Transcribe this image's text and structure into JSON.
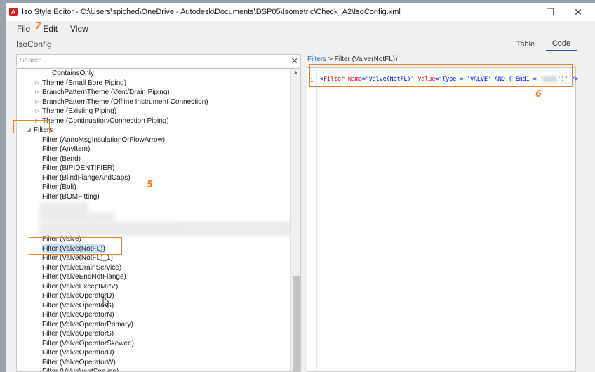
{
  "window": {
    "title": "Iso Style Editor - C:\\Users\\spiched\\OneDrive - Autodesk\\Documents\\DSP05\\Isometric\\Check_A2\\IsoConfig.xml",
    "app_icon": "A",
    "minimize_icon": "—",
    "maximize_icon": "☐",
    "close_icon": "✕"
  },
  "menu": {
    "items": [
      "File",
      "Edit",
      "View"
    ]
  },
  "doc_title": "IsoConfig",
  "view_tabs": [
    "Table",
    "Code"
  ],
  "active_view_tab": "Code",
  "search": {
    "placeholder": "Search...",
    "clear_icon": "✕"
  },
  "tree": {
    "rows": [
      {
        "label": "ContainsOnly",
        "arrow": ""
      },
      {
        "label": "Theme (Small Bore Piping)",
        "arrow": "▷"
      },
      {
        "label": "BranchPatternTheme (Vent/Drain Piping)",
        "arrow": "▷"
      },
      {
        "label": "BranchPatternTheme (Offline Instrument Connection)",
        "arrow": "▷"
      },
      {
        "label": "Theme (Existing Piping)",
        "arrow": "▷"
      },
      {
        "label": "Theme (Continuation/Connection Piping)",
        "arrow": "▷"
      },
      {
        "label": "Filters",
        "arrow": "◢"
      },
      {
        "label": "Filter (AnnoMsgInsulationOrFlowArrow)",
        "arrow": ""
      },
      {
        "label": "Filter (AnyItem)",
        "arrow": ""
      },
      {
        "label": "Filter (Bend)",
        "arrow": ""
      },
      {
        "label": "Filter (BIPIDENTIFIER)",
        "arrow": ""
      },
      {
        "label": "Filter (BlindFlangeAndCaps)",
        "arrow": ""
      },
      {
        "label": "Filter (Bolt)",
        "arrow": ""
      },
      {
        "label": "Filter (BOMFitting)",
        "arrow": ""
      }
    ],
    "rows_lower": [
      {
        "label": "Filter (Valve)",
        "arrow": ""
      },
      {
        "label": "Filter (Valve(NotFL))",
        "arrow": ""
      },
      {
        "label": "Filter (Valve(NotFL)_1)",
        "arrow": ""
      },
      {
        "label": "Filter (ValveDrainService)",
        "arrow": ""
      },
      {
        "label": "Filter (ValveEndNotFlange)",
        "arrow": ""
      },
      {
        "label": "Filter (ValveExceptMPV)",
        "arrow": ""
      },
      {
        "label": "Filter (ValveOperatorD)",
        "arrow": ""
      },
      {
        "label": "Filter (ValveOperatorS)",
        "arrow": ""
      },
      {
        "label": "Filter (ValveOperatorN)",
        "arrow": ""
      },
      {
        "label": "Filter (ValveOperatorPrimary)",
        "arrow": ""
      },
      {
        "label": "Filter (ValveOperatorS)",
        "arrow": ""
      },
      {
        "label": "Filter (ValveOperatorSkewed)",
        "arrow": ""
      },
      {
        "label": "Filter (ValveOperatorU)",
        "arrow": ""
      },
      {
        "label": "Filter (ValveOperatorW)",
        "arrow": ""
      },
      {
        "label": "Filter (ValveVentService)",
        "arrow": ""
      }
    ],
    "selected_label": "Filter (Valve(NotFL))"
  },
  "breadcrumb": {
    "root": "Filters",
    "separator": ">",
    "current": "Filter (Valve(NotFL))"
  },
  "code": {
    "line_number": "1",
    "open": "<",
    "tag": "Filter",
    "attr1_name": "Name",
    "attr1_value": "\"Valve(NotFL)\"",
    "attr2_name": "Value",
    "attr2_value": "\"Type = 'VALVE' AND ( End1 = '",
    "attr2_value_end": "')\"",
    "close": "/>"
  },
  "annotations": {
    "step5": "5",
    "step6": "6",
    "step7": "7",
    "accent_color": "#e8822a"
  }
}
